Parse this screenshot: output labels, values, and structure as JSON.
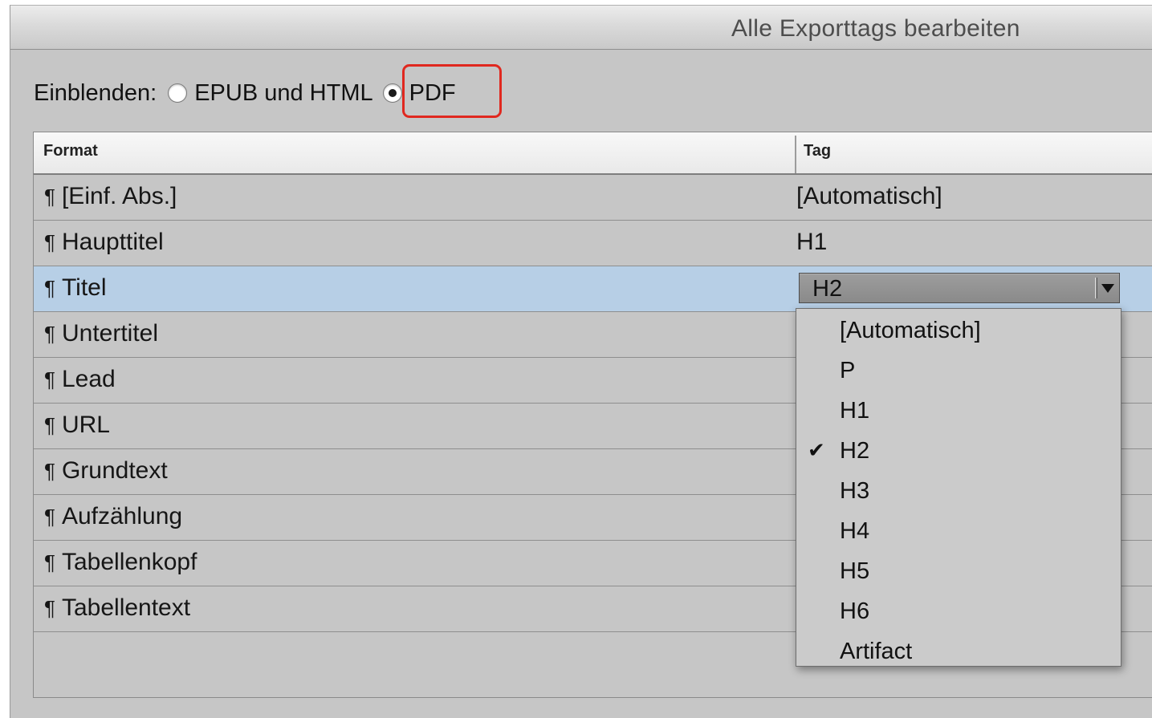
{
  "window": {
    "title": "Alle Exporttags bearbeiten"
  },
  "show": {
    "label": "Einblenden:",
    "options": [
      {
        "label": "EPUB und HTML",
        "checked": false
      },
      {
        "label": "PDF",
        "checked": true
      }
    ]
  },
  "table": {
    "columns": {
      "format": "Format",
      "tag": "Tag"
    },
    "pilcrow": "¶",
    "rows": [
      {
        "format": "[Einf. Abs.]",
        "tag": "[Automatisch]"
      },
      {
        "format": "Haupttitel",
        "tag": "H1"
      },
      {
        "format": "Titel",
        "tag": "H2",
        "selected": true
      },
      {
        "format": "Untertitel",
        "tag": ""
      },
      {
        "format": "Lead",
        "tag": ""
      },
      {
        "format": "URL",
        "tag": ""
      },
      {
        "format": "Grundtext",
        "tag": ""
      },
      {
        "format": "Aufzählung",
        "tag": ""
      },
      {
        "format": "Tabellenkopf",
        "tag": ""
      },
      {
        "format": "Tabellentext",
        "tag": ""
      }
    ]
  },
  "tag_select": {
    "value": "H2",
    "options": [
      {
        "label": "[Automatisch]",
        "checked": false
      },
      {
        "label": "P",
        "checked": false
      },
      {
        "label": "H1",
        "checked": false
      },
      {
        "label": "H2",
        "checked": true
      },
      {
        "label": "H3",
        "checked": false
      },
      {
        "label": "H4",
        "checked": false
      },
      {
        "label": "H5",
        "checked": false
      },
      {
        "label": "H6",
        "checked": false
      },
      {
        "label": "Artifact",
        "checked": false
      }
    ],
    "check_glyph": "✔"
  },
  "colors": {
    "highlight": "#e0281f",
    "selected_row": "#b7cfe6"
  }
}
